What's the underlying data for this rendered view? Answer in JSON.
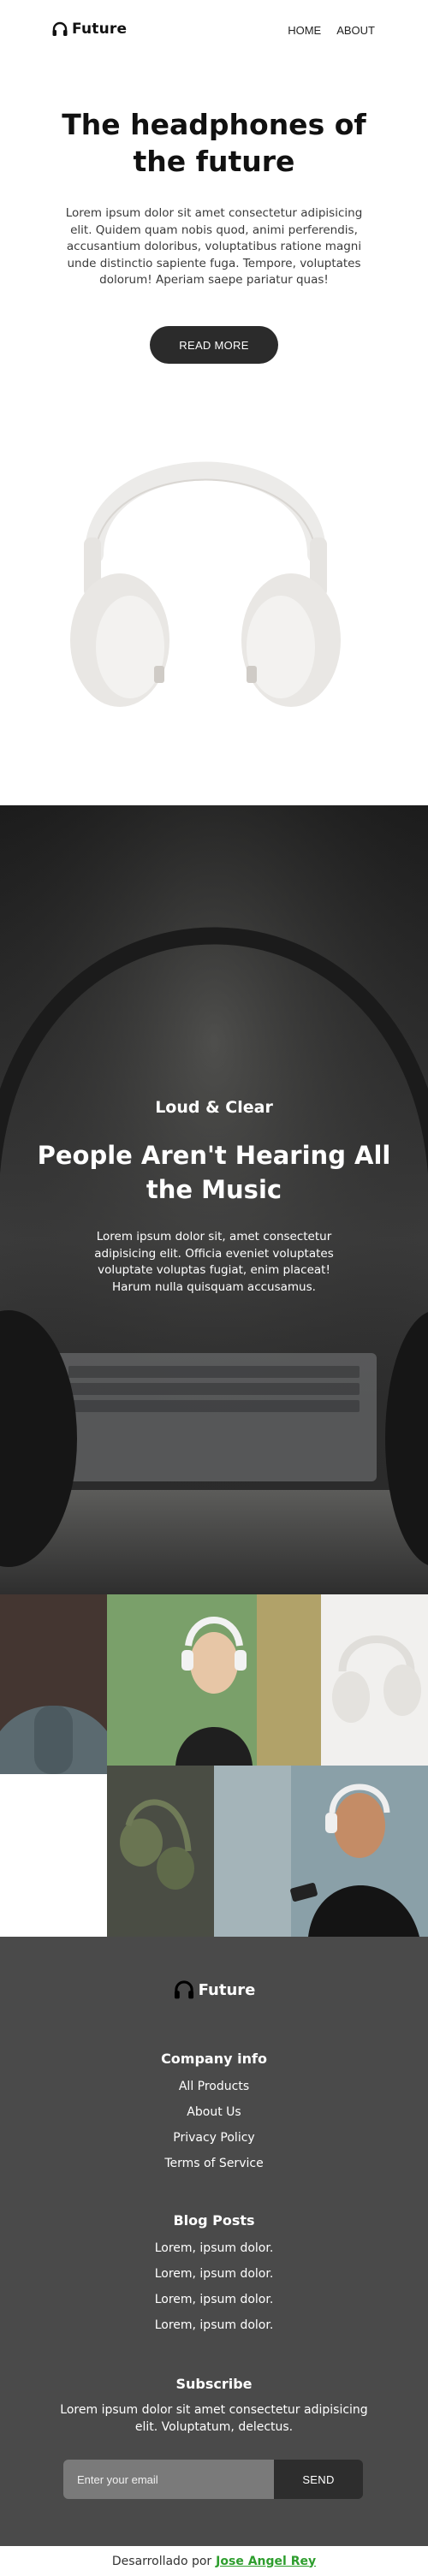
{
  "header": {
    "brand": "Future",
    "nav": [
      {
        "label": "HOME"
      },
      {
        "label": "ABOUT"
      }
    ]
  },
  "hero": {
    "title": "The headphones of the future",
    "text": "Lorem ipsum dolor sit amet consectetur adipisicing elit. Quidem quam nobis quod, animi perferendis, accusantium doloribus, voluptatibus ratione magni unde distinctio sapiente fuga. Tempore, voluptates dolorum! Aperiam saepe pariatur quas!",
    "button": "READ MORE",
    "image_icon": "white-headphones-image"
  },
  "feature": {
    "kicker": "Loud & Clear",
    "title": "People Aren't Hearing All the Music",
    "text": "Lorem ipsum dolor sit, amet consectetur adipisicing elit. Officia eveniet voluptates voluptate voluptas fugiat, enim placeat! Harum nulla quisquam accusamus."
  },
  "gallery": {
    "images": [
      "microphone-image",
      "woman-with-headphones-image",
      "white-headphones-image",
      "green-headphones-image",
      "man-with-headphones-image"
    ]
  },
  "footer": {
    "brand": "Future",
    "company": {
      "title": "Company info",
      "items": [
        "All Products",
        "About Us",
        "Privacy Policy",
        "Terms of Service"
      ]
    },
    "blog": {
      "title": "Blog Posts",
      "items": [
        "Lorem, ipsum dolor.",
        "Lorem, ipsum dolor.",
        "Lorem, ipsum dolor.",
        "Lorem, ipsum dolor."
      ]
    },
    "subscribe": {
      "title": "Subscribe",
      "text": "Lorem ipsum dolor sit amet consectetur adipisicing elit. Voluptatum, delectus.",
      "placeholder": "Enter your email",
      "button": "SEND"
    }
  },
  "credit": {
    "prefix": "Desarrollado por",
    "author": "Jose Angel Rey"
  },
  "colors": {
    "dark": "#2b2b2b",
    "footer_bg": "#4a4a4a",
    "link_green": "#2e9e2e"
  }
}
